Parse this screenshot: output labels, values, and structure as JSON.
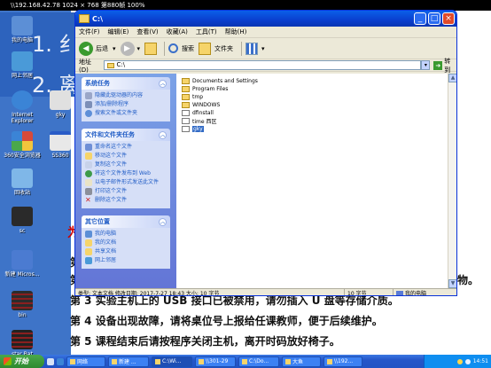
{
  "rdp_bar": {
    "text": "\\\\192.168.42.78 1024 × 768 第880帧 100%"
  },
  "slide": {
    "heading1": "1. 纟",
    "heading2": "2. 离",
    "red_mark": "为",
    "rules": [
      {
        "text": "第"
      },
      {
        "text": "第",
        "tail": "物。"
      },
      {
        "text": "第 3 实验主机上的 USB 接口已被禁用，请勿插入 U 盘等存储介质。"
      },
      {
        "text": "第 4 设备出现故障，请将桌位号上报给任课教师，便于后续维护。"
      },
      {
        "text": "第 5 课程结束后请按程序关闭主机，离开时码放好椅子。"
      }
    ]
  },
  "desktop_icons": [
    {
      "label": "我的电脑",
      "color": "#5c8fd6"
    },
    {
      "label": "网上邻居",
      "color": "#4a9ad8"
    },
    {
      "label": "Internet Explorer",
      "color": "#3b84d6"
    },
    {
      "label": "gky",
      "color": "#e0e0e0"
    },
    {
      "label": "360安全浏览器",
      "color": "#d64a3a"
    },
    {
      "label": "SS360",
      "color": "#e8e8e8"
    },
    {
      "label": "回收站",
      "color": "#7fb7e8"
    },
    {
      "label": "sc",
      "color": "#2a2a2a"
    },
    {
      "label": "新建 Micros...",
      "color": "#4b7bd1"
    },
    {
      "label": "bin",
      "color": "#2c2c2c"
    },
    {
      "label": "star Bat",
      "color": "#222222"
    }
  ],
  "explorer": {
    "title": "C:\\",
    "menu": [
      "文件(F)",
      "编辑(E)",
      "查看(V)",
      "收藏(A)",
      "工具(T)",
      "帮助(H)"
    ],
    "toolbar": {
      "back": "后退",
      "search": "搜索",
      "folders": "文件夹"
    },
    "address": {
      "label": "地址(D)",
      "value": "C:\\",
      "go": "转到"
    },
    "task_groups": [
      {
        "title": "系统任务",
        "items": [
          "隐藏此驱动器的内容",
          "添加/删除程序",
          "搜索文件或文件夹"
        ]
      },
      {
        "title": "文件和文件夹任务",
        "items": [
          "重命名这个文件",
          "移动这个文件",
          "复制这个文件",
          "将这个文件发布到 Web",
          "以电子邮件形式发送此文件",
          "打印这个文件",
          "删除这个文件"
        ]
      },
      {
        "title": "其它位置",
        "items": [
          "我的电脑",
          "我的文档",
          "共享文档",
          "网上邻居"
        ]
      }
    ],
    "files": [
      {
        "name": "Documents and Settings",
        "type": "folder"
      },
      {
        "name": "Program Files",
        "type": "folder"
      },
      {
        "name": "tmp",
        "type": "folder"
      },
      {
        "name": "WINDOWS",
        "type": "folder"
      },
      {
        "name": "dfinstall",
        "type": "file"
      },
      {
        "name": "time 西区",
        "type": "file"
      },
      {
        "name": "gky",
        "type": "file",
        "selected": true
      }
    ],
    "status": {
      "left": "类型: 文本文档 修改日期: 2017-7-27 18:43 大小: 10 字节",
      "size": "10 字节",
      "location": "我的电脑"
    }
  },
  "taskbar": {
    "start": "开始",
    "buttons": [
      {
        "label": "网络",
        "active": false
      },
      {
        "label": "新建 ...",
        "active": false
      },
      {
        "label": "C:\\Wi...",
        "active": false
      },
      {
        "label": "\\\\301-29",
        "active": false
      },
      {
        "label": "C:\\Do...",
        "active": false
      },
      {
        "label": "大鱼",
        "active": false
      },
      {
        "label": "\\\\192...",
        "active": true
      }
    ],
    "clock": "14:51"
  }
}
